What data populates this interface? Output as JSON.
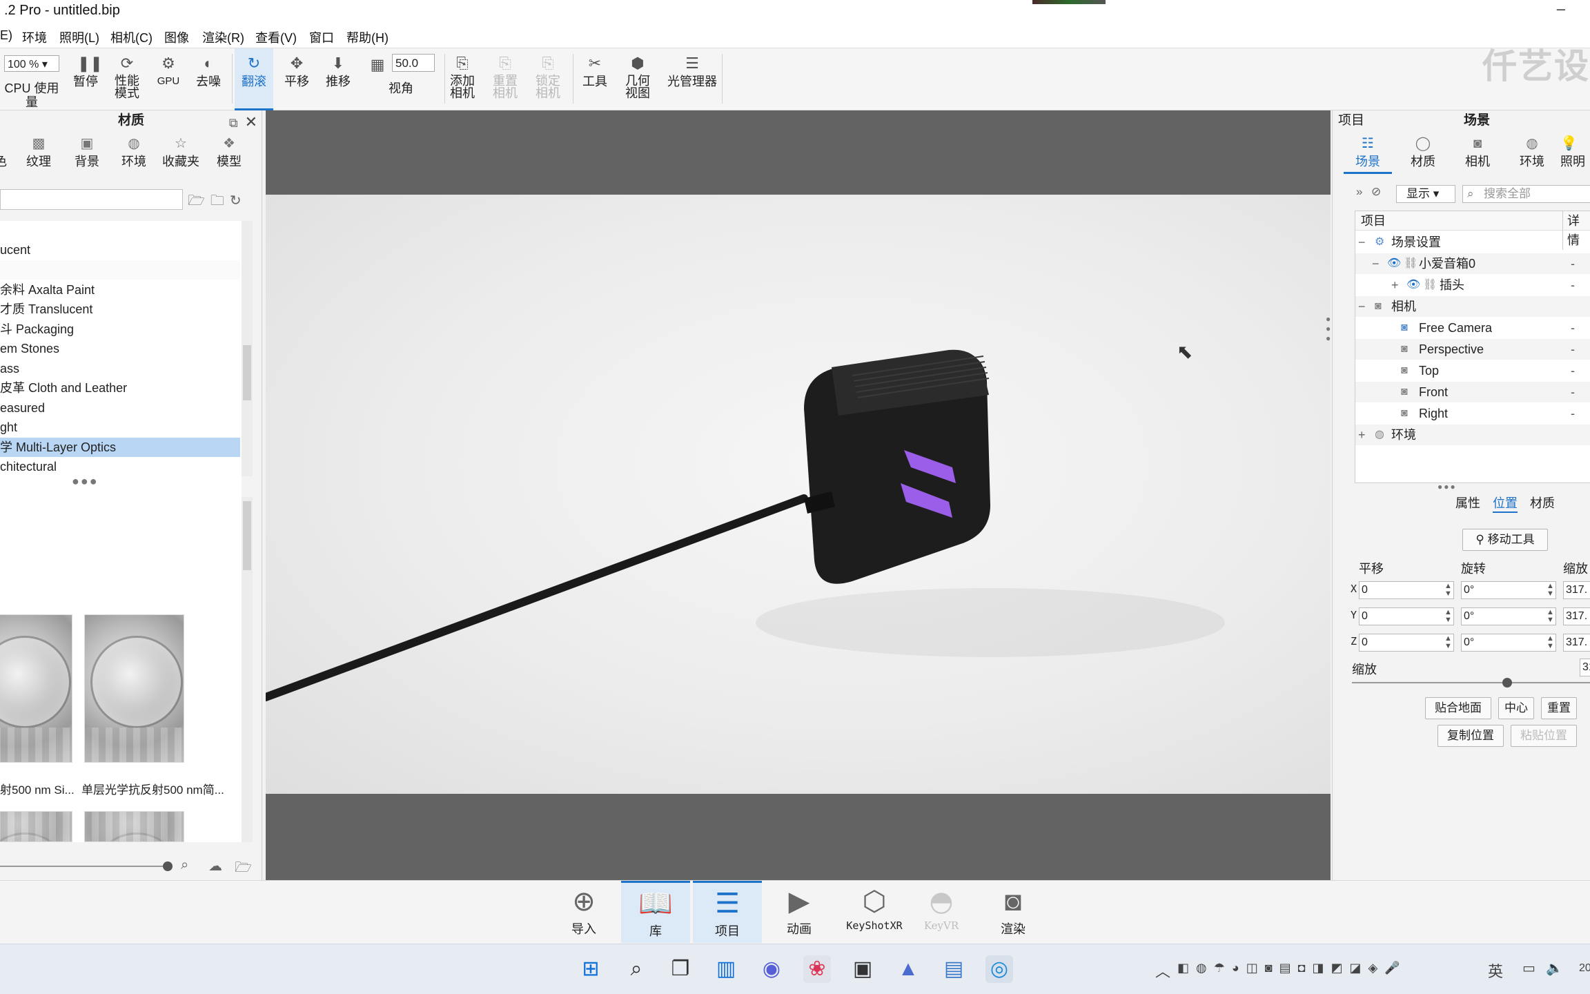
{
  "window": {
    "title": ".2 Pro  - untitled.bip",
    "minimize": "–"
  },
  "menu": [
    "E)",
    "环境",
    "照明(L)",
    "相机(C)",
    "图像",
    "渲染(R)",
    "查看(V)",
    "窗口",
    "帮助(H)"
  ],
  "toolbar": {
    "zoom": "100 %",
    "cpu_label": "CPU 使用量",
    "items": [
      {
        "label": "暂停",
        "icon": "pause-icon"
      },
      {
        "label": "性能\n模式",
        "icon": "performance-icon"
      },
      {
        "label": "GPU",
        "icon": "gpu-icon"
      },
      {
        "label": "去噪",
        "icon": "denoise-icon"
      },
      {
        "label": "翻滚",
        "icon": "tumble-icon",
        "active": true
      },
      {
        "label": "平移",
        "icon": "pan-icon"
      },
      {
        "label": "推移",
        "icon": "dolly-icon"
      }
    ],
    "fov_value": "50.0",
    "fov_label": "视角",
    "add_camera": "添加\n相机",
    "reset_camera": "重置\n相机",
    "lock_camera": "锁定\n相机",
    "tools": "工具",
    "geometry_view": "几何\n视图",
    "light_manager": "光管理器",
    "watermark": "仟艺设"
  },
  "library": {
    "title": "材质",
    "tabs": [
      "色",
      "纹理",
      "背景",
      "环境",
      "收藏夹",
      "模型"
    ],
    "search_placeholder": "",
    "list": [
      "",
      "ucent",
      "",
      "余料 Axalta Paint",
      "才质 Translucent",
      "斗 Packaging",
      "em Stones",
      "ass",
      "皮革 Cloth and Leather",
      "easured",
      "ght",
      "学 Multi-Layer Optics",
      "chitectural"
    ],
    "selected_index": 11,
    "thumb_captions": [
      "射500 nm Si...",
      "单层光学抗反射500 nm简..."
    ]
  },
  "project": {
    "header_left": "项目",
    "header_title": "场景",
    "tabs": [
      "场景",
      "材质",
      "相机",
      "环境",
      "照明"
    ],
    "display_label": "显示",
    "search_placeholder": "搜索全部",
    "tree_header": "项目",
    "tree_header_right": "详情",
    "rows": [
      {
        "label": "场景设置",
        "detail": "-"
      },
      {
        "label": "小爱音箱0",
        "detail": "-"
      },
      {
        "label": "插头",
        "detail": "-"
      },
      {
        "label": "相机",
        "detail": ""
      },
      {
        "label": "Free Camera",
        "detail": "-"
      },
      {
        "label": "Perspective",
        "detail": "-"
      },
      {
        "label": "Top",
        "detail": "-"
      },
      {
        "label": "Front",
        "detail": "-"
      },
      {
        "label": "Right",
        "detail": "-"
      },
      {
        "label": "环境",
        "detail": ""
      }
    ],
    "sub_tabs": [
      "属性",
      "位置",
      "材质"
    ],
    "move_tool": "移动工具",
    "col_translate": "平移",
    "col_rotate": "旋转",
    "col_scale": "缩放",
    "axes": [
      "X",
      "Y",
      "Z"
    ],
    "translate": [
      "0",
      "0",
      "0"
    ],
    "rotate": [
      "0°",
      "0°",
      "0°"
    ],
    "scale": [
      "317.",
      "317.",
      "317."
    ],
    "uniform_scale_label": "缩放",
    "uniform_scale_value": "31",
    "uniform_scale_level": 0.65,
    "btn_snap": "贴合地面",
    "btn_center": "中心",
    "btn_reset": "重置",
    "btn_copy": "复制位置",
    "btn_paste": "粘贴位置"
  },
  "dock": [
    {
      "label": "导入",
      "icon": "import-icon"
    },
    {
      "label": "库",
      "icon": "library-icon",
      "active": true
    },
    {
      "label": "项目",
      "icon": "project-icon",
      "active": true
    },
    {
      "label": "动画",
      "icon": "animation-icon"
    },
    {
      "label": "KeyShotXR",
      "icon": "keyshotxr-icon"
    },
    {
      "label": "KeyVR",
      "icon": "keyvr-icon",
      "disabled": true
    },
    {
      "label": "渲染",
      "icon": "render-icon"
    }
  ],
  "taskbar": {
    "ime": "英",
    "clock_partial": "20"
  },
  "colors": {
    "accent": "#1d72c9",
    "viewport_bg": "#636363",
    "selection": "#b9d7f4"
  }
}
